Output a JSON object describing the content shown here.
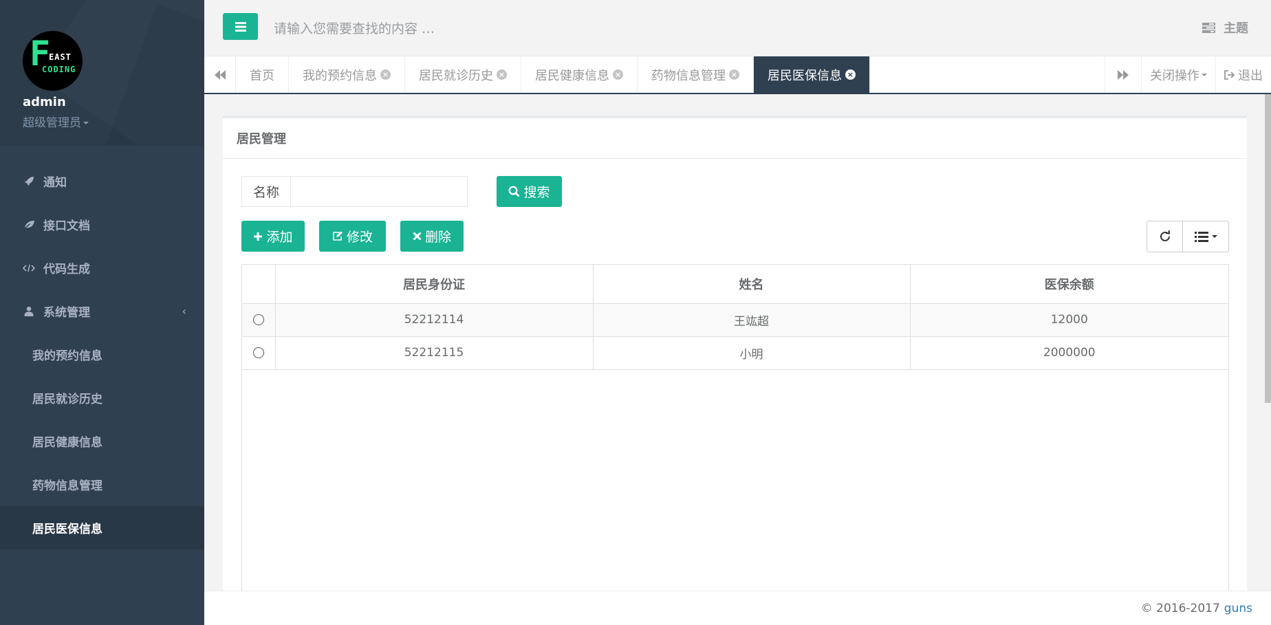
{
  "brand": {
    "logo_f": "F",
    "logo_line1": "EAST",
    "logo_line2": "CODING"
  },
  "user": {
    "name": "admin",
    "role": "超级管理员"
  },
  "sidebar": {
    "items": [
      {
        "label": "通知",
        "icon": "rocket-icon"
      },
      {
        "label": "接口文档",
        "icon": "leaf-icon"
      },
      {
        "label": "代码生成",
        "icon": "code-icon"
      },
      {
        "label": "系统管理",
        "icon": "user-icon"
      }
    ],
    "sub_items": [
      {
        "label": "我的预约信息"
      },
      {
        "label": "居民就诊历史"
      },
      {
        "label": "居民健康信息"
      },
      {
        "label": "药物信息管理"
      },
      {
        "label": "居民医保信息",
        "active": true
      }
    ]
  },
  "header": {
    "search_placeholder": "请输入您需要查找的内容 …",
    "theme_label": "主题"
  },
  "tabs": {
    "home": "首页",
    "items": [
      "我的预约信息",
      "居民就诊历史",
      "居民健康信息",
      "药物信息管理",
      "居民医保信息"
    ],
    "active": "居民医保信息",
    "close_ops": "关闭操作",
    "logout": "退出"
  },
  "panel": {
    "title": "居民管理",
    "search_label": "名称",
    "search_value": "",
    "search_button": "搜索",
    "add_button": "添加",
    "edit_button": "修改",
    "delete_button": "删除"
  },
  "table": {
    "headers": [
      "居民身份证",
      "姓名",
      "医保余额"
    ],
    "rows": [
      {
        "id_card": "52212114",
        "name": "王竑超",
        "balance": "12000"
      },
      {
        "id_card": "52212115",
        "name": "小明",
        "balance": "2000000"
      }
    ]
  },
  "footer": {
    "copyright": "© 2016-2017",
    "link": "guns"
  },
  "colors": {
    "sidebar": "#2f4050",
    "accent": "#1ab394",
    "link": "#337ab7"
  }
}
